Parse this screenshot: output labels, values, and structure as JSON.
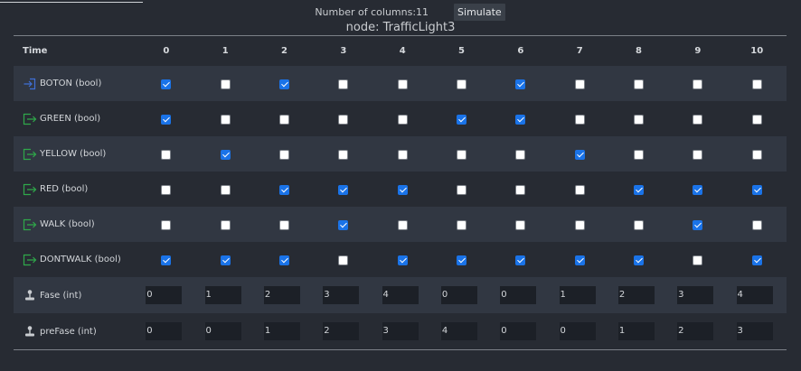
{
  "controls": {
    "num_columns_label": "Number of columns:",
    "num_columns_value": "11",
    "simulate_label": "Simulate"
  },
  "node_title": "node: TrafficLight3",
  "grid": {
    "time_header": "Time",
    "columns": [
      "0",
      "1",
      "2",
      "3",
      "4",
      "5",
      "6",
      "7",
      "8",
      "9",
      "10"
    ],
    "rows": [
      {
        "label": "BOTON (bool)",
        "kind": "bool",
        "icon": "input-arrow-icon",
        "icon_color": "#3f6fd6",
        "values": [
          true,
          false,
          true,
          false,
          false,
          false,
          true,
          false,
          false,
          false,
          false
        ]
      },
      {
        "label": "GREEN (bool)",
        "kind": "bool",
        "icon": "output-arrow-icon",
        "icon_color": "#2fa84a",
        "values": [
          true,
          false,
          false,
          false,
          false,
          true,
          true,
          false,
          false,
          false,
          false
        ]
      },
      {
        "label": "YELLOW (bool)",
        "kind": "bool",
        "icon": "output-arrow-icon",
        "icon_color": "#2fa84a",
        "values": [
          false,
          true,
          false,
          false,
          false,
          false,
          false,
          true,
          false,
          false,
          false
        ]
      },
      {
        "label": "RED (bool)",
        "kind": "bool",
        "icon": "output-arrow-icon",
        "icon_color": "#2fa84a",
        "values": [
          false,
          false,
          true,
          true,
          true,
          false,
          false,
          false,
          true,
          true,
          true
        ]
      },
      {
        "label": "WALK (bool)",
        "kind": "bool",
        "icon": "output-arrow-icon",
        "icon_color": "#2fa84a",
        "values": [
          false,
          false,
          false,
          true,
          false,
          false,
          false,
          false,
          false,
          true,
          false
        ]
      },
      {
        "label": "DONTWALK (bool)",
        "kind": "bool",
        "icon": "output-arrow-icon",
        "icon_color": "#2fa84a",
        "values": [
          true,
          true,
          true,
          false,
          true,
          true,
          true,
          true,
          true,
          false,
          true
        ]
      },
      {
        "label": "Fase (int)",
        "kind": "int",
        "icon": "joystick-icon",
        "icon_color": "#c9ccd0",
        "values": [
          "0",
          "1",
          "2",
          "3",
          "4",
          "0",
          "0",
          "1",
          "2",
          "3",
          "4"
        ]
      },
      {
        "label": "preFase (int)",
        "kind": "int",
        "icon": "joystick-icon",
        "icon_color": "#c9ccd0",
        "values": [
          "0",
          "0",
          "1",
          "2",
          "3",
          "4",
          "0",
          "0",
          "1",
          "2",
          "3"
        ]
      }
    ]
  }
}
